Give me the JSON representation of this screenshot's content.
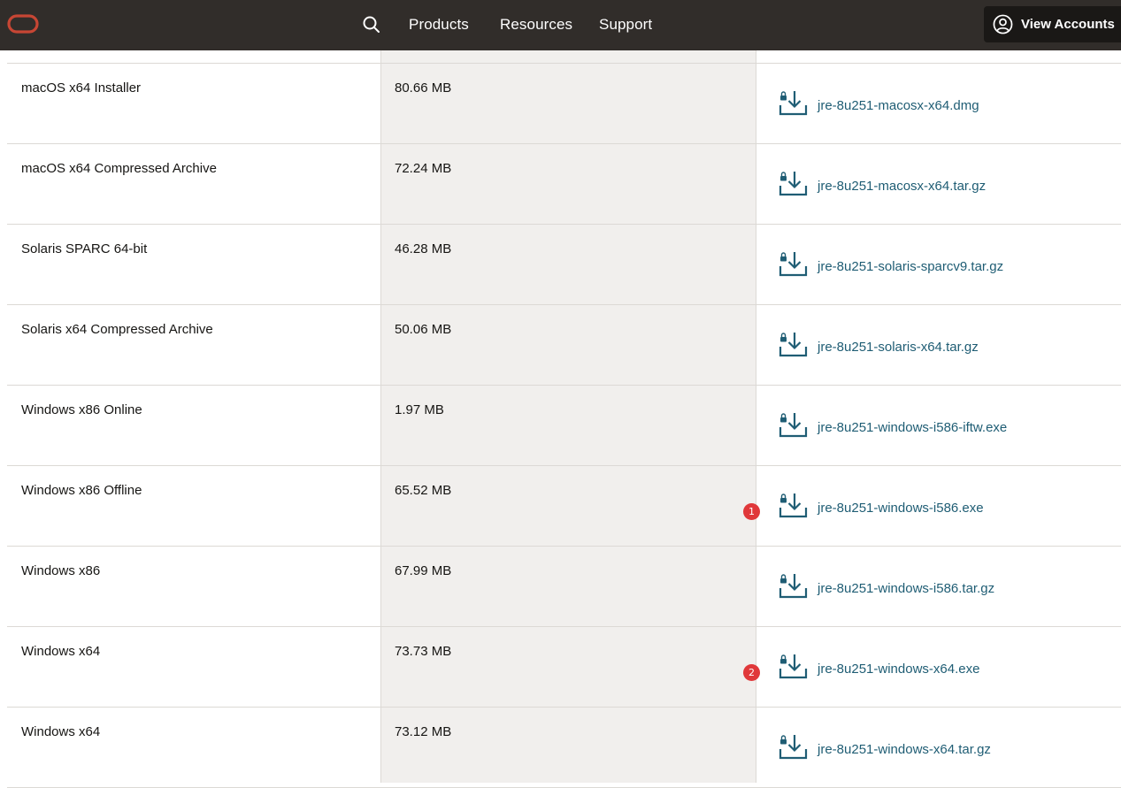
{
  "header": {
    "logo_icon": "oracle-logo-icon",
    "search_icon": "search-icon",
    "nav": [
      "Products",
      "Resources",
      "Support"
    ],
    "account_icon": "user-circle-icon",
    "account_label": "View Accounts",
    "colors": {
      "bar": "#312d2a",
      "logo": "#c74634"
    }
  },
  "table": {
    "link_color": "#1f5d74",
    "download_icon": "download-lock-icon",
    "rows": [
      {
        "product": "macOS x64 Installer",
        "size": "80.66 MB",
        "file": "jre-8u251-macosx-x64.dmg"
      },
      {
        "product": "macOS x64 Compressed Archive",
        "size": "72.24 MB",
        "file": "jre-8u251-macosx-x64.tar.gz"
      },
      {
        "product": "Solaris SPARC 64-bit",
        "size": "46.28 MB",
        "file": "jre-8u251-solaris-sparcv9.tar.gz"
      },
      {
        "product": "Solaris x64 Compressed Archive",
        "size": "50.06 MB",
        "file": "jre-8u251-solaris-x64.tar.gz"
      },
      {
        "product": "Windows x86 Online",
        "size": "1.97 MB",
        "file": "jre-8u251-windows-i586-iftw.exe"
      },
      {
        "product": "Windows x86 Offline",
        "size": "65.52 MB",
        "file": "jre-8u251-windows-i586.exe",
        "badge": "1"
      },
      {
        "product": "Windows x86",
        "size": "67.99 MB",
        "file": "jre-8u251-windows-i586.tar.gz"
      },
      {
        "product": "Windows x64",
        "size": "73.73 MB",
        "file": "jre-8u251-windows-x64.exe",
        "badge": "2"
      },
      {
        "product": "Windows x64",
        "size": "73.12 MB",
        "file": "jre-8u251-windows-x64.tar.gz"
      }
    ]
  }
}
